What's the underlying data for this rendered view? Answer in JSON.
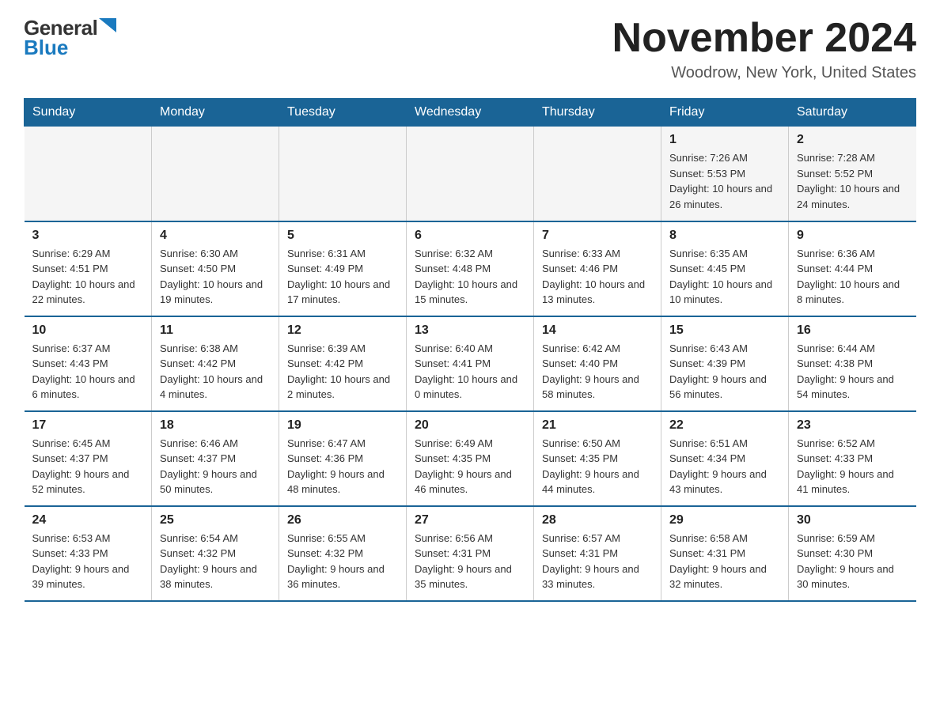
{
  "logo": {
    "general": "General",
    "blue": "Blue"
  },
  "title": {
    "month": "November 2024",
    "location": "Woodrow, New York, United States"
  },
  "weekdays": [
    "Sunday",
    "Monday",
    "Tuesday",
    "Wednesday",
    "Thursday",
    "Friday",
    "Saturday"
  ],
  "weeks": [
    [
      {
        "day": null,
        "info": null
      },
      {
        "day": null,
        "info": null
      },
      {
        "day": null,
        "info": null
      },
      {
        "day": null,
        "info": null
      },
      {
        "day": null,
        "info": null
      },
      {
        "day": "1",
        "info": "Sunrise: 7:26 AM\nSunset: 5:53 PM\nDaylight: 10 hours and 26 minutes."
      },
      {
        "day": "2",
        "info": "Sunrise: 7:28 AM\nSunset: 5:52 PM\nDaylight: 10 hours and 24 minutes."
      }
    ],
    [
      {
        "day": "3",
        "info": "Sunrise: 6:29 AM\nSunset: 4:51 PM\nDaylight: 10 hours and 22 minutes."
      },
      {
        "day": "4",
        "info": "Sunrise: 6:30 AM\nSunset: 4:50 PM\nDaylight: 10 hours and 19 minutes."
      },
      {
        "day": "5",
        "info": "Sunrise: 6:31 AM\nSunset: 4:49 PM\nDaylight: 10 hours and 17 minutes."
      },
      {
        "day": "6",
        "info": "Sunrise: 6:32 AM\nSunset: 4:48 PM\nDaylight: 10 hours and 15 minutes."
      },
      {
        "day": "7",
        "info": "Sunrise: 6:33 AM\nSunset: 4:46 PM\nDaylight: 10 hours and 13 minutes."
      },
      {
        "day": "8",
        "info": "Sunrise: 6:35 AM\nSunset: 4:45 PM\nDaylight: 10 hours and 10 minutes."
      },
      {
        "day": "9",
        "info": "Sunrise: 6:36 AM\nSunset: 4:44 PM\nDaylight: 10 hours and 8 minutes."
      }
    ],
    [
      {
        "day": "10",
        "info": "Sunrise: 6:37 AM\nSunset: 4:43 PM\nDaylight: 10 hours and 6 minutes."
      },
      {
        "day": "11",
        "info": "Sunrise: 6:38 AM\nSunset: 4:42 PM\nDaylight: 10 hours and 4 minutes."
      },
      {
        "day": "12",
        "info": "Sunrise: 6:39 AM\nSunset: 4:42 PM\nDaylight: 10 hours and 2 minutes."
      },
      {
        "day": "13",
        "info": "Sunrise: 6:40 AM\nSunset: 4:41 PM\nDaylight: 10 hours and 0 minutes."
      },
      {
        "day": "14",
        "info": "Sunrise: 6:42 AM\nSunset: 4:40 PM\nDaylight: 9 hours and 58 minutes."
      },
      {
        "day": "15",
        "info": "Sunrise: 6:43 AM\nSunset: 4:39 PM\nDaylight: 9 hours and 56 minutes."
      },
      {
        "day": "16",
        "info": "Sunrise: 6:44 AM\nSunset: 4:38 PM\nDaylight: 9 hours and 54 minutes."
      }
    ],
    [
      {
        "day": "17",
        "info": "Sunrise: 6:45 AM\nSunset: 4:37 PM\nDaylight: 9 hours and 52 minutes."
      },
      {
        "day": "18",
        "info": "Sunrise: 6:46 AM\nSunset: 4:37 PM\nDaylight: 9 hours and 50 minutes."
      },
      {
        "day": "19",
        "info": "Sunrise: 6:47 AM\nSunset: 4:36 PM\nDaylight: 9 hours and 48 minutes."
      },
      {
        "day": "20",
        "info": "Sunrise: 6:49 AM\nSunset: 4:35 PM\nDaylight: 9 hours and 46 minutes."
      },
      {
        "day": "21",
        "info": "Sunrise: 6:50 AM\nSunset: 4:35 PM\nDaylight: 9 hours and 44 minutes."
      },
      {
        "day": "22",
        "info": "Sunrise: 6:51 AM\nSunset: 4:34 PM\nDaylight: 9 hours and 43 minutes."
      },
      {
        "day": "23",
        "info": "Sunrise: 6:52 AM\nSunset: 4:33 PM\nDaylight: 9 hours and 41 minutes."
      }
    ],
    [
      {
        "day": "24",
        "info": "Sunrise: 6:53 AM\nSunset: 4:33 PM\nDaylight: 9 hours and 39 minutes."
      },
      {
        "day": "25",
        "info": "Sunrise: 6:54 AM\nSunset: 4:32 PM\nDaylight: 9 hours and 38 minutes."
      },
      {
        "day": "26",
        "info": "Sunrise: 6:55 AM\nSunset: 4:32 PM\nDaylight: 9 hours and 36 minutes."
      },
      {
        "day": "27",
        "info": "Sunrise: 6:56 AM\nSunset: 4:31 PM\nDaylight: 9 hours and 35 minutes."
      },
      {
        "day": "28",
        "info": "Sunrise: 6:57 AM\nSunset: 4:31 PM\nDaylight: 9 hours and 33 minutes."
      },
      {
        "day": "29",
        "info": "Sunrise: 6:58 AM\nSunset: 4:31 PM\nDaylight: 9 hours and 32 minutes."
      },
      {
        "day": "30",
        "info": "Sunrise: 6:59 AM\nSunset: 4:30 PM\nDaylight: 9 hours and 30 minutes."
      }
    ]
  ]
}
